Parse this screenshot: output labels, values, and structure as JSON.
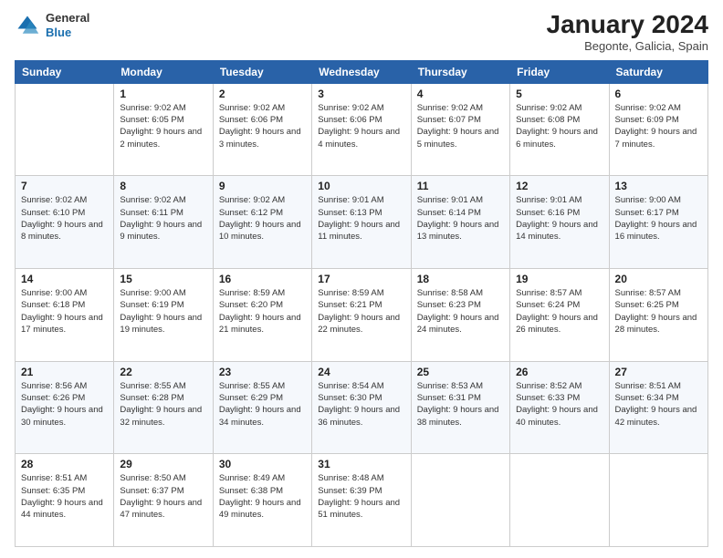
{
  "header": {
    "logo_general": "General",
    "logo_blue": "Blue",
    "title": "January 2024",
    "location": "Begonte, Galicia, Spain"
  },
  "days_of_week": [
    "Sunday",
    "Monday",
    "Tuesday",
    "Wednesday",
    "Thursday",
    "Friday",
    "Saturday"
  ],
  "weeks": [
    [
      {
        "day": "",
        "sunrise": "",
        "sunset": "",
        "daylight": ""
      },
      {
        "day": "1",
        "sunrise": "Sunrise: 9:02 AM",
        "sunset": "Sunset: 6:05 PM",
        "daylight": "Daylight: 9 hours and 2 minutes."
      },
      {
        "day": "2",
        "sunrise": "Sunrise: 9:02 AM",
        "sunset": "Sunset: 6:06 PM",
        "daylight": "Daylight: 9 hours and 3 minutes."
      },
      {
        "day": "3",
        "sunrise": "Sunrise: 9:02 AM",
        "sunset": "Sunset: 6:06 PM",
        "daylight": "Daylight: 9 hours and 4 minutes."
      },
      {
        "day": "4",
        "sunrise": "Sunrise: 9:02 AM",
        "sunset": "Sunset: 6:07 PM",
        "daylight": "Daylight: 9 hours and 5 minutes."
      },
      {
        "day": "5",
        "sunrise": "Sunrise: 9:02 AM",
        "sunset": "Sunset: 6:08 PM",
        "daylight": "Daylight: 9 hours and 6 minutes."
      },
      {
        "day": "6",
        "sunrise": "Sunrise: 9:02 AM",
        "sunset": "Sunset: 6:09 PM",
        "daylight": "Daylight: 9 hours and 7 minutes."
      }
    ],
    [
      {
        "day": "7",
        "sunrise": "Sunrise: 9:02 AM",
        "sunset": "Sunset: 6:10 PM",
        "daylight": "Daylight: 9 hours and 8 minutes."
      },
      {
        "day": "8",
        "sunrise": "Sunrise: 9:02 AM",
        "sunset": "Sunset: 6:11 PM",
        "daylight": "Daylight: 9 hours and 9 minutes."
      },
      {
        "day": "9",
        "sunrise": "Sunrise: 9:02 AM",
        "sunset": "Sunset: 6:12 PM",
        "daylight": "Daylight: 9 hours and 10 minutes."
      },
      {
        "day": "10",
        "sunrise": "Sunrise: 9:01 AM",
        "sunset": "Sunset: 6:13 PM",
        "daylight": "Daylight: 9 hours and 11 minutes."
      },
      {
        "day": "11",
        "sunrise": "Sunrise: 9:01 AM",
        "sunset": "Sunset: 6:14 PM",
        "daylight": "Daylight: 9 hours and 13 minutes."
      },
      {
        "day": "12",
        "sunrise": "Sunrise: 9:01 AM",
        "sunset": "Sunset: 6:16 PM",
        "daylight": "Daylight: 9 hours and 14 minutes."
      },
      {
        "day": "13",
        "sunrise": "Sunrise: 9:00 AM",
        "sunset": "Sunset: 6:17 PM",
        "daylight": "Daylight: 9 hours and 16 minutes."
      }
    ],
    [
      {
        "day": "14",
        "sunrise": "Sunrise: 9:00 AM",
        "sunset": "Sunset: 6:18 PM",
        "daylight": "Daylight: 9 hours and 17 minutes."
      },
      {
        "day": "15",
        "sunrise": "Sunrise: 9:00 AM",
        "sunset": "Sunset: 6:19 PM",
        "daylight": "Daylight: 9 hours and 19 minutes."
      },
      {
        "day": "16",
        "sunrise": "Sunrise: 8:59 AM",
        "sunset": "Sunset: 6:20 PM",
        "daylight": "Daylight: 9 hours and 21 minutes."
      },
      {
        "day": "17",
        "sunrise": "Sunrise: 8:59 AM",
        "sunset": "Sunset: 6:21 PM",
        "daylight": "Daylight: 9 hours and 22 minutes."
      },
      {
        "day": "18",
        "sunrise": "Sunrise: 8:58 AM",
        "sunset": "Sunset: 6:23 PM",
        "daylight": "Daylight: 9 hours and 24 minutes."
      },
      {
        "day": "19",
        "sunrise": "Sunrise: 8:57 AM",
        "sunset": "Sunset: 6:24 PM",
        "daylight": "Daylight: 9 hours and 26 minutes."
      },
      {
        "day": "20",
        "sunrise": "Sunrise: 8:57 AM",
        "sunset": "Sunset: 6:25 PM",
        "daylight": "Daylight: 9 hours and 28 minutes."
      }
    ],
    [
      {
        "day": "21",
        "sunrise": "Sunrise: 8:56 AM",
        "sunset": "Sunset: 6:26 PM",
        "daylight": "Daylight: 9 hours and 30 minutes."
      },
      {
        "day": "22",
        "sunrise": "Sunrise: 8:55 AM",
        "sunset": "Sunset: 6:28 PM",
        "daylight": "Daylight: 9 hours and 32 minutes."
      },
      {
        "day": "23",
        "sunrise": "Sunrise: 8:55 AM",
        "sunset": "Sunset: 6:29 PM",
        "daylight": "Daylight: 9 hours and 34 minutes."
      },
      {
        "day": "24",
        "sunrise": "Sunrise: 8:54 AM",
        "sunset": "Sunset: 6:30 PM",
        "daylight": "Daylight: 9 hours and 36 minutes."
      },
      {
        "day": "25",
        "sunrise": "Sunrise: 8:53 AM",
        "sunset": "Sunset: 6:31 PM",
        "daylight": "Daylight: 9 hours and 38 minutes."
      },
      {
        "day": "26",
        "sunrise": "Sunrise: 8:52 AM",
        "sunset": "Sunset: 6:33 PM",
        "daylight": "Daylight: 9 hours and 40 minutes."
      },
      {
        "day": "27",
        "sunrise": "Sunrise: 8:51 AM",
        "sunset": "Sunset: 6:34 PM",
        "daylight": "Daylight: 9 hours and 42 minutes."
      }
    ],
    [
      {
        "day": "28",
        "sunrise": "Sunrise: 8:51 AM",
        "sunset": "Sunset: 6:35 PM",
        "daylight": "Daylight: 9 hours and 44 minutes."
      },
      {
        "day": "29",
        "sunrise": "Sunrise: 8:50 AM",
        "sunset": "Sunset: 6:37 PM",
        "daylight": "Daylight: 9 hours and 47 minutes."
      },
      {
        "day": "30",
        "sunrise": "Sunrise: 8:49 AM",
        "sunset": "Sunset: 6:38 PM",
        "daylight": "Daylight: 9 hours and 49 minutes."
      },
      {
        "day": "31",
        "sunrise": "Sunrise: 8:48 AM",
        "sunset": "Sunset: 6:39 PM",
        "daylight": "Daylight: 9 hours and 51 minutes."
      },
      {
        "day": "",
        "sunrise": "",
        "sunset": "",
        "daylight": ""
      },
      {
        "day": "",
        "sunrise": "",
        "sunset": "",
        "daylight": ""
      },
      {
        "day": "",
        "sunrise": "",
        "sunset": "",
        "daylight": ""
      }
    ]
  ]
}
